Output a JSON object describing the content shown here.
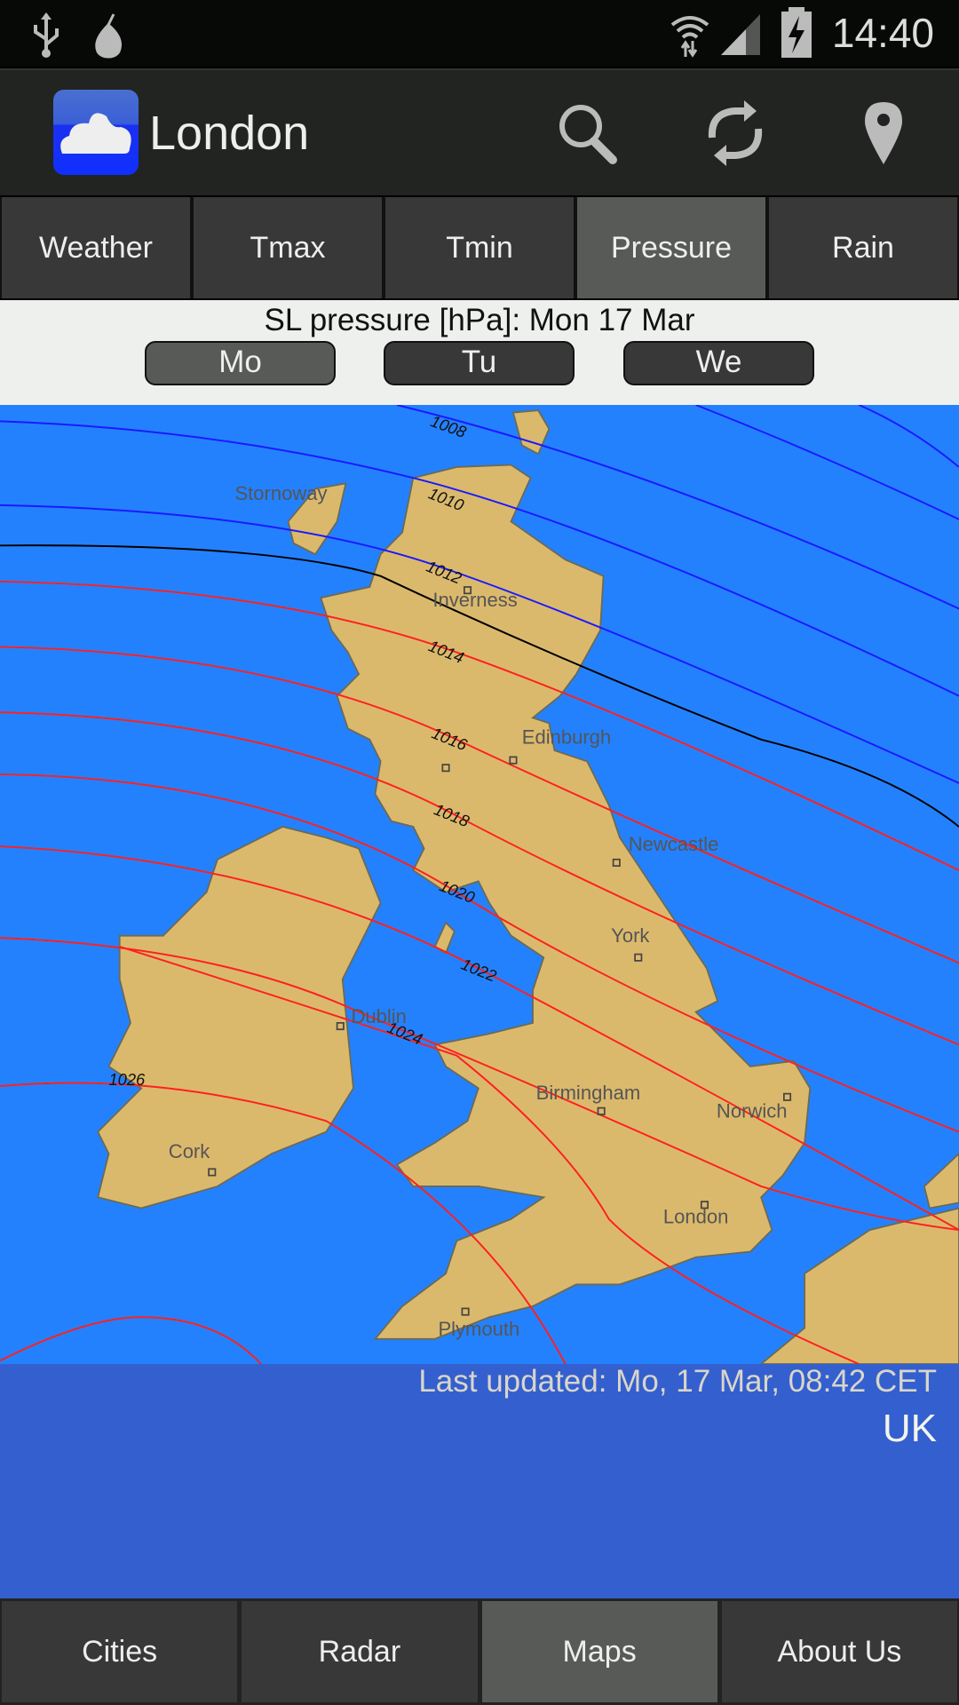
{
  "status_bar": {
    "time": "14:40",
    "icons": [
      "usb-icon",
      "onion-icon",
      "wifi-icon",
      "signal-icon",
      "battery-charging-icon"
    ]
  },
  "app_bar": {
    "title": "London",
    "icons": [
      "app-cloud-icon",
      "search-icon",
      "refresh-icon",
      "location-pin-icon"
    ]
  },
  "tabs": [
    {
      "label": "Weather",
      "active": false
    },
    {
      "label": "Tmax",
      "active": false
    },
    {
      "label": "Tmin",
      "active": false
    },
    {
      "label": "Pressure",
      "active": true
    },
    {
      "label": "Rain",
      "active": false
    }
  ],
  "map_header": {
    "caption": "SL pressure [hPa]: Mon 17 Mar",
    "days": [
      {
        "label": "Mo",
        "active": true
      },
      {
        "label": "Tu",
        "active": false
      },
      {
        "label": "We",
        "active": false
      }
    ]
  },
  "map": {
    "cities": [
      "Stornoway",
      "Inverness",
      "Edinburgh",
      "Newcastle",
      "York",
      "Dublin",
      "Birmingham",
      "Norwich",
      "Cork",
      "London",
      "Plymouth"
    ],
    "isobars": [
      "1008",
      "1010",
      "1012",
      "1014",
      "1016",
      "1018",
      "1020",
      "1022",
      "1024",
      "1026"
    ],
    "colors": {
      "sea": "#2481fd",
      "land": "#dbb96c",
      "low_isobar": "#1a1aff",
      "high_isobar": "#ff2020",
      "reference_isobar": "#000000"
    }
  },
  "info": {
    "last_updated": "Last updated: Mo, 17 Mar, 08:42 CET",
    "region": "UK"
  },
  "bottom_nav": [
    {
      "label": "Cities",
      "active": false
    },
    {
      "label": "Radar",
      "active": false
    },
    {
      "label": "Maps",
      "active": true
    },
    {
      "label": "About Us",
      "active": false
    }
  ]
}
